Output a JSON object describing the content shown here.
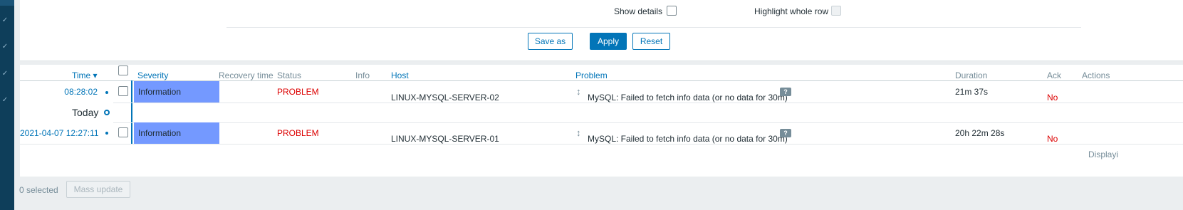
{
  "filter": {
    "show_details_label": "Show details",
    "highlight_row_label": "Highlight whole row",
    "save_as_label": "Save as",
    "apply_label": "Apply",
    "reset_label": "Reset"
  },
  "table": {
    "headers": {
      "time": "Time ▾",
      "severity": "Severity",
      "recovery_time": "Recovery time",
      "status": "Status",
      "info": "Info",
      "host": "Host",
      "problem": "Problem",
      "duration": "Duration",
      "ack": "Ack",
      "actions": "Actions"
    },
    "today_label": "Today",
    "rows": [
      {
        "time": "08:28:02",
        "severity": "Information",
        "status": "PROBLEM",
        "host": "LINUX-MYSQL-SERVER-02",
        "problem": "MySQL: Failed to fetch info data (or no data for 30m)",
        "duration": "21m 37s",
        "ack": "No"
      },
      {
        "time": "2021-04-07 12:27:11",
        "severity": "Information",
        "status": "PROBLEM",
        "host": "LINUX-MYSQL-SERVER-01",
        "problem": "MySQL: Failed to fetch info data (or no data for 30m)",
        "duration": "20h 22m 28s",
        "ack": "No"
      }
    ],
    "displaying_label": "Displayi"
  },
  "footer": {
    "selected_label": "0 selected",
    "mass_update_label": "Mass update"
  },
  "colors": {
    "accent": "#0275b8",
    "severity_information": "#7499ff",
    "problem_red": "#dc0000",
    "nav_bg": "#0e3e5a"
  },
  "icons": {
    "hint": "?",
    "updown": "↕",
    "nav_chevron": "✓"
  }
}
